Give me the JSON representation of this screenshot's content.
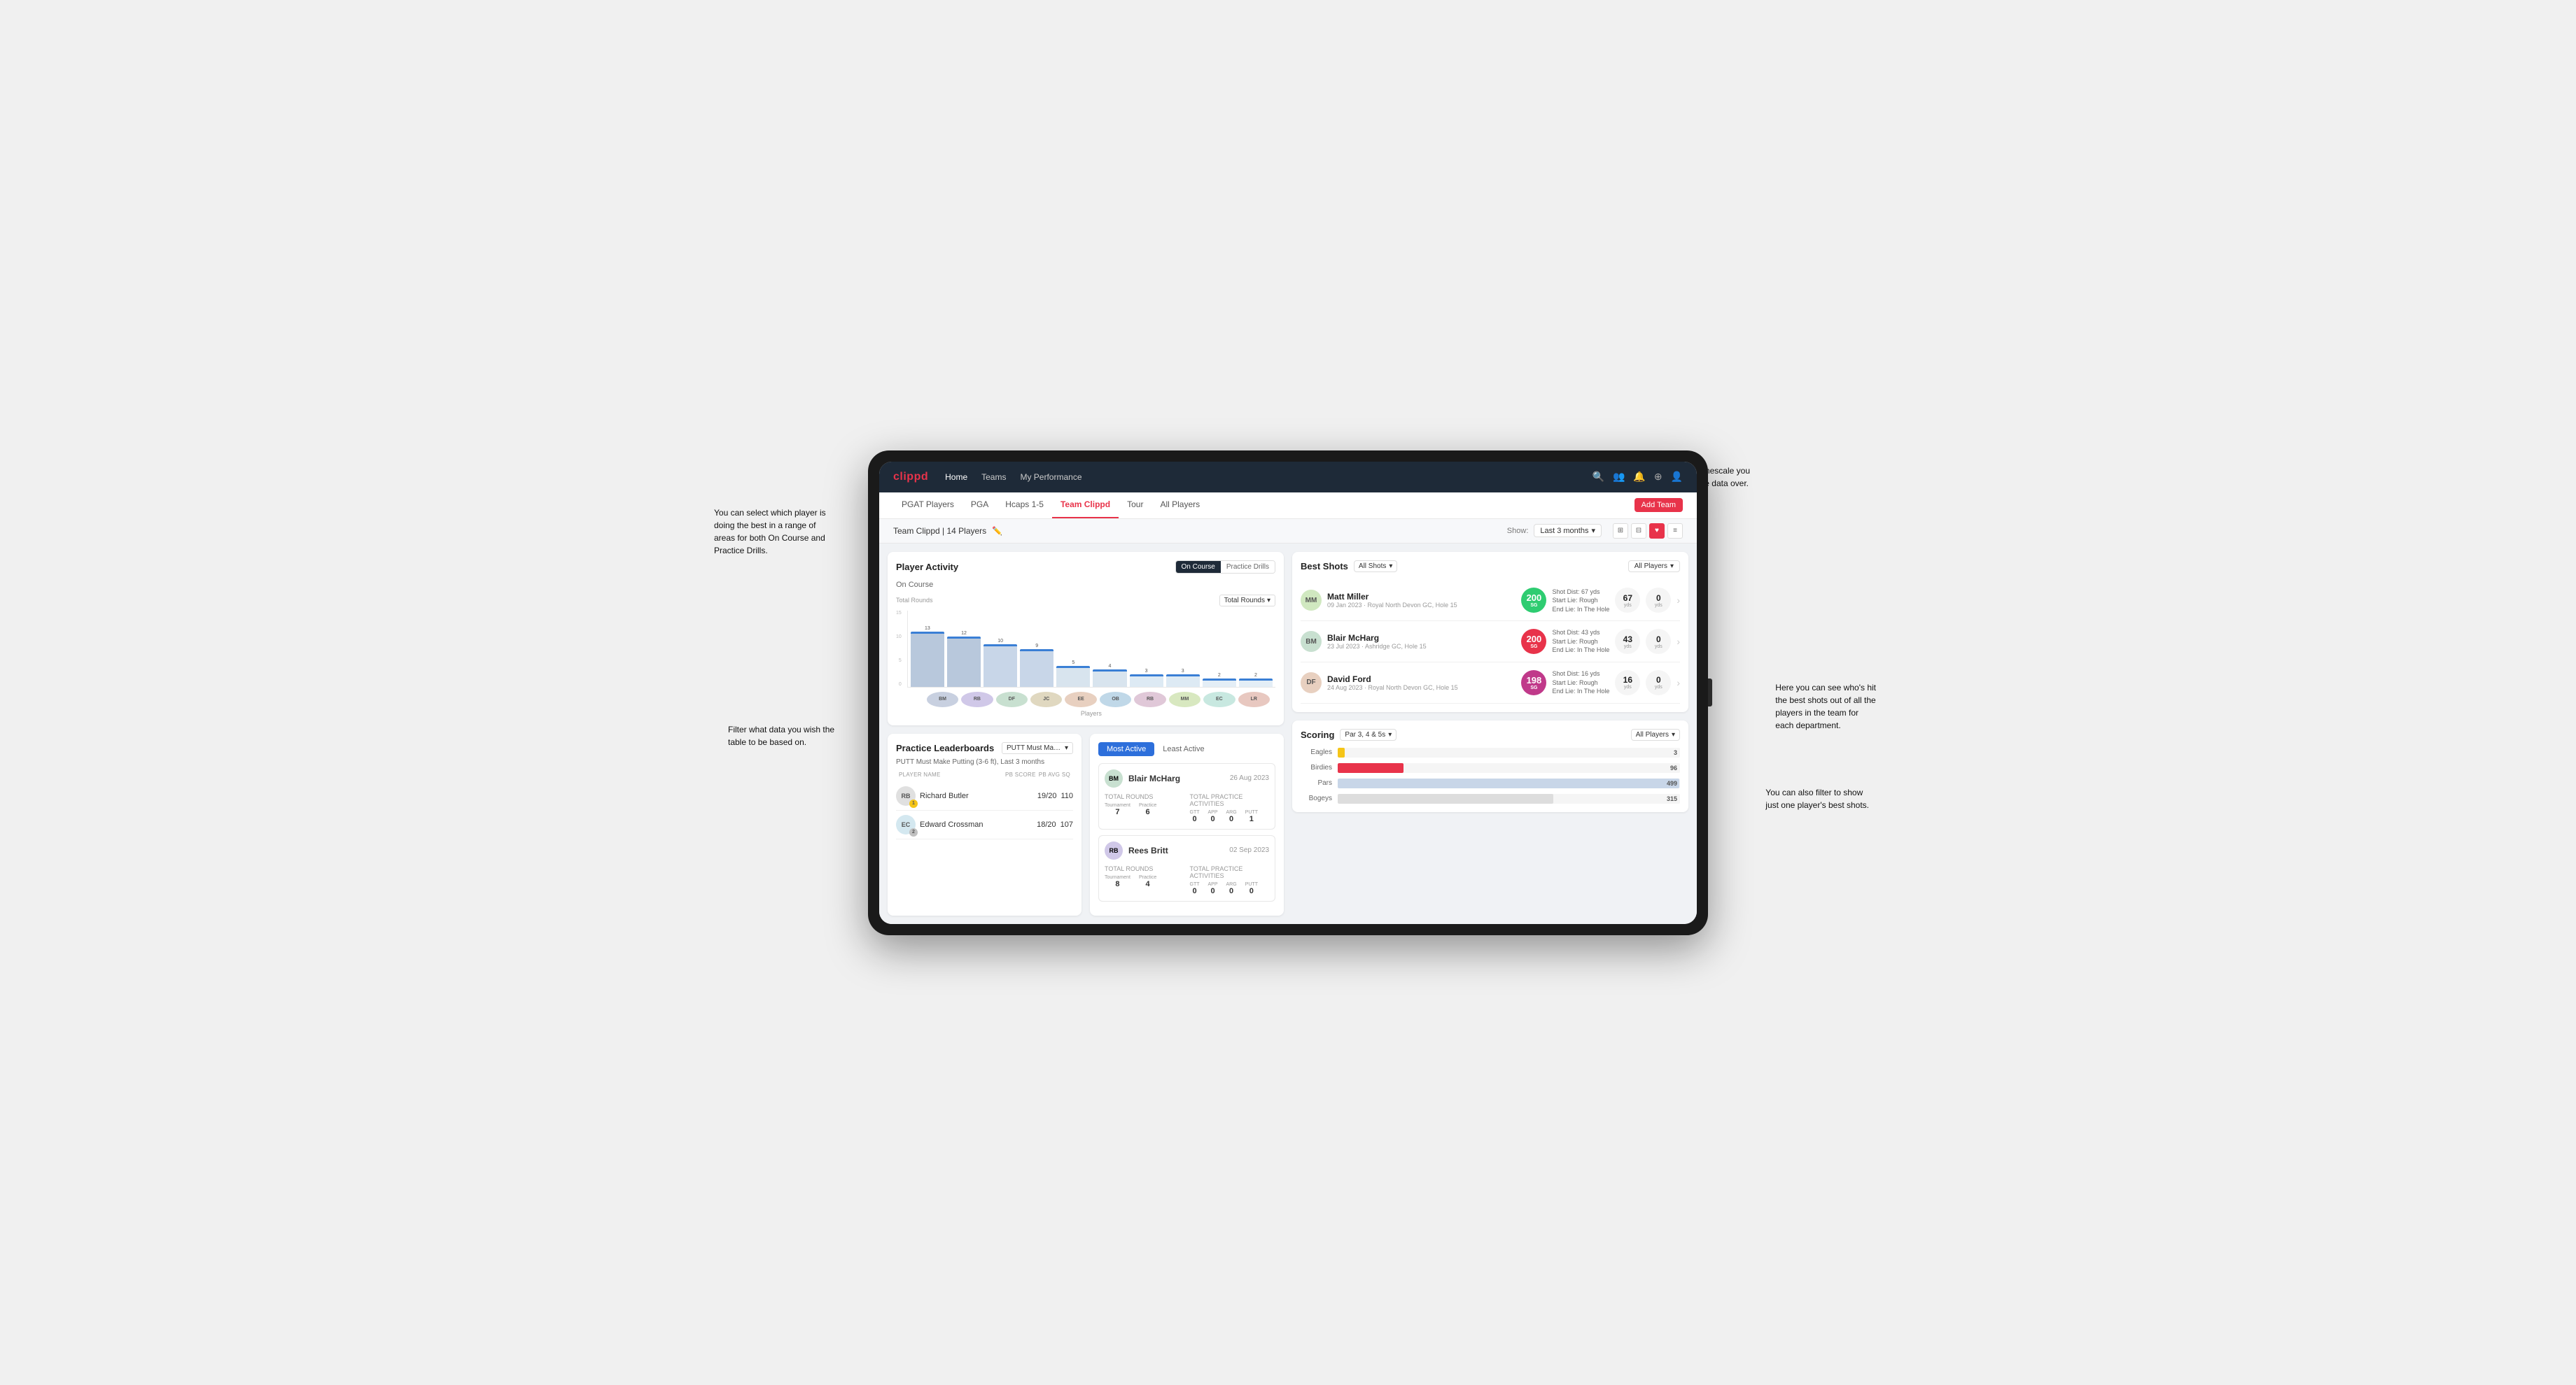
{
  "annotations": {
    "top_right": "Choose the timescale you\nwish to see the data over.",
    "left_top": "You can select which player is\ndoing the best in a range of\nareas for both On Course and\nPractice Drills.",
    "left_bottom": "Filter what data you wish the\ntable to be based on.",
    "right_mid": "Here you can see who's hit\nthe best shots out of all the\nplayers in the team for\neach department.",
    "right_bottom": "You can also filter to show\njust one player's best shots."
  },
  "topnav": {
    "logo": "clippd",
    "links": [
      "Home",
      "Teams",
      "My Performance"
    ],
    "icons": [
      "search",
      "people",
      "bell",
      "add-circle",
      "profile"
    ]
  },
  "subnav": {
    "items": [
      "PGAT Players",
      "PGA",
      "Hcaps 1-5",
      "Team Clippd",
      "Tour",
      "All Players"
    ],
    "active": "Team Clippd",
    "add_button": "Add Team"
  },
  "teamheader": {
    "title": "Team Clippd | 14 Players",
    "show_label": "Show:",
    "show_value": "Last 3 months",
    "views": [
      "grid-large",
      "grid",
      "heart",
      "list"
    ]
  },
  "player_activity": {
    "title": "Player Activity",
    "toggle_options": [
      "On Course",
      "Practice Drills"
    ],
    "active_toggle": "On Course",
    "section": "On Course",
    "chart_dropdown": "Total Rounds",
    "y_axis_label": "Total Rounds",
    "y_ticks": [
      "15",
      "10",
      "5",
      "0"
    ],
    "bars": [
      {
        "name": "B. McHarg",
        "value": 13,
        "height_pct": 87
      },
      {
        "name": "R. Britt",
        "value": 12,
        "height_pct": 80
      },
      {
        "name": "D. Ford",
        "value": 10,
        "height_pct": 67
      },
      {
        "name": "J. Coles",
        "value": 9,
        "height_pct": 60
      },
      {
        "name": "E. Ebert",
        "value": 5,
        "height_pct": 33
      },
      {
        "name": "O. Billingham",
        "value": 4,
        "height_pct": 27
      },
      {
        "name": "R. Butler",
        "value": 3,
        "height_pct": 20
      },
      {
        "name": "M. Miller",
        "value": 3,
        "height_pct": 20
      },
      {
        "name": "E. Crossman",
        "value": 2,
        "height_pct": 13
      },
      {
        "name": "L. Robertson",
        "value": 2,
        "height_pct": 13
      }
    ],
    "x_axis_label": "Players"
  },
  "practice_leaderboards": {
    "title": "Practice Leaderboards",
    "dropdown": "PUTT Must Make Putting...",
    "subtitle": "PUTT Must Make Putting (3-6 ft), Last 3 months",
    "columns": [
      "PLAYER NAME",
      "PB SCORE",
      "PB AVG SQ"
    ],
    "players": [
      {
        "name": "Richard Butler",
        "score": "19/20",
        "avg": "110",
        "rank": 1
      },
      {
        "name": "Edward Crossman",
        "score": "18/20",
        "avg": "107",
        "rank": 2
      }
    ]
  },
  "most_active": {
    "tabs": [
      "Most Active",
      "Least Active"
    ],
    "active_tab": "Most Active",
    "players": [
      {
        "name": "Blair McHarg",
        "date": "26 Aug 2023",
        "total_rounds_label": "Total Rounds",
        "tournament": "7",
        "practice": "6",
        "total_practice_label": "Total Practice Activities",
        "gtt": "0",
        "app": "0",
        "arg": "0",
        "putt": "1"
      },
      {
        "name": "Rees Britt",
        "date": "02 Sep 2023",
        "total_rounds_label": "Total Rounds",
        "tournament": "8",
        "practice": "4",
        "total_practice_label": "Total Practice Activities",
        "gtt": "0",
        "app": "0",
        "arg": "0",
        "putt": "0"
      }
    ]
  },
  "best_shots": {
    "title": "Best Shots",
    "filter1": "All Shots",
    "filter2": "All Players",
    "players": [
      {
        "name": "Matt Miller",
        "meta": "09 Jan 2023 · Royal North Devon GC, Hole 15",
        "badge_num": "200",
        "badge_label": "SG",
        "badge_color": "green",
        "desc": "Shot Dist: 67 yds\nStart Lie: Rough\nEnd Lie: In The Hole",
        "stat1": "67",
        "stat1_unit": "yds",
        "stat2": "0",
        "stat2_unit": "yds"
      },
      {
        "name": "Blair McHarg",
        "meta": "23 Jul 2023 · Ashridge GC, Hole 15",
        "badge_num": "200",
        "badge_label": "SG",
        "badge_color": "pink",
        "desc": "Shot Dist: 43 yds\nStart Lie: Rough\nEnd Lie: In The Hole",
        "stat1": "43",
        "stat1_unit": "yds",
        "stat2": "0",
        "stat2_unit": "yds"
      },
      {
        "name": "David Ford",
        "meta": "24 Aug 2023 · Royal North Devon GC, Hole 15",
        "badge_num": "198",
        "badge_label": "SG",
        "badge_color": "pink",
        "desc": "Shot Dist: 16 yds\nStart Lie: Rough\nEnd Lie: In The Hole",
        "stat1": "16",
        "stat1_unit": "yds",
        "stat2": "0",
        "stat2_unit": "yds"
      }
    ]
  },
  "scoring": {
    "title": "Scoring",
    "filter1": "Par 3, 4 & 5s",
    "filter2": "All Players",
    "rows": [
      {
        "label": "Eagles",
        "value": 3,
        "max": 500,
        "color": "eagles"
      },
      {
        "label": "Birdies",
        "value": 96,
        "max": 500,
        "color": "birdies"
      },
      {
        "label": "Pars",
        "value": 499,
        "max": 500,
        "color": "pars"
      },
      {
        "label": "Bogeys",
        "value": 315,
        "max": 500,
        "color": "bogeys"
      }
    ]
  }
}
